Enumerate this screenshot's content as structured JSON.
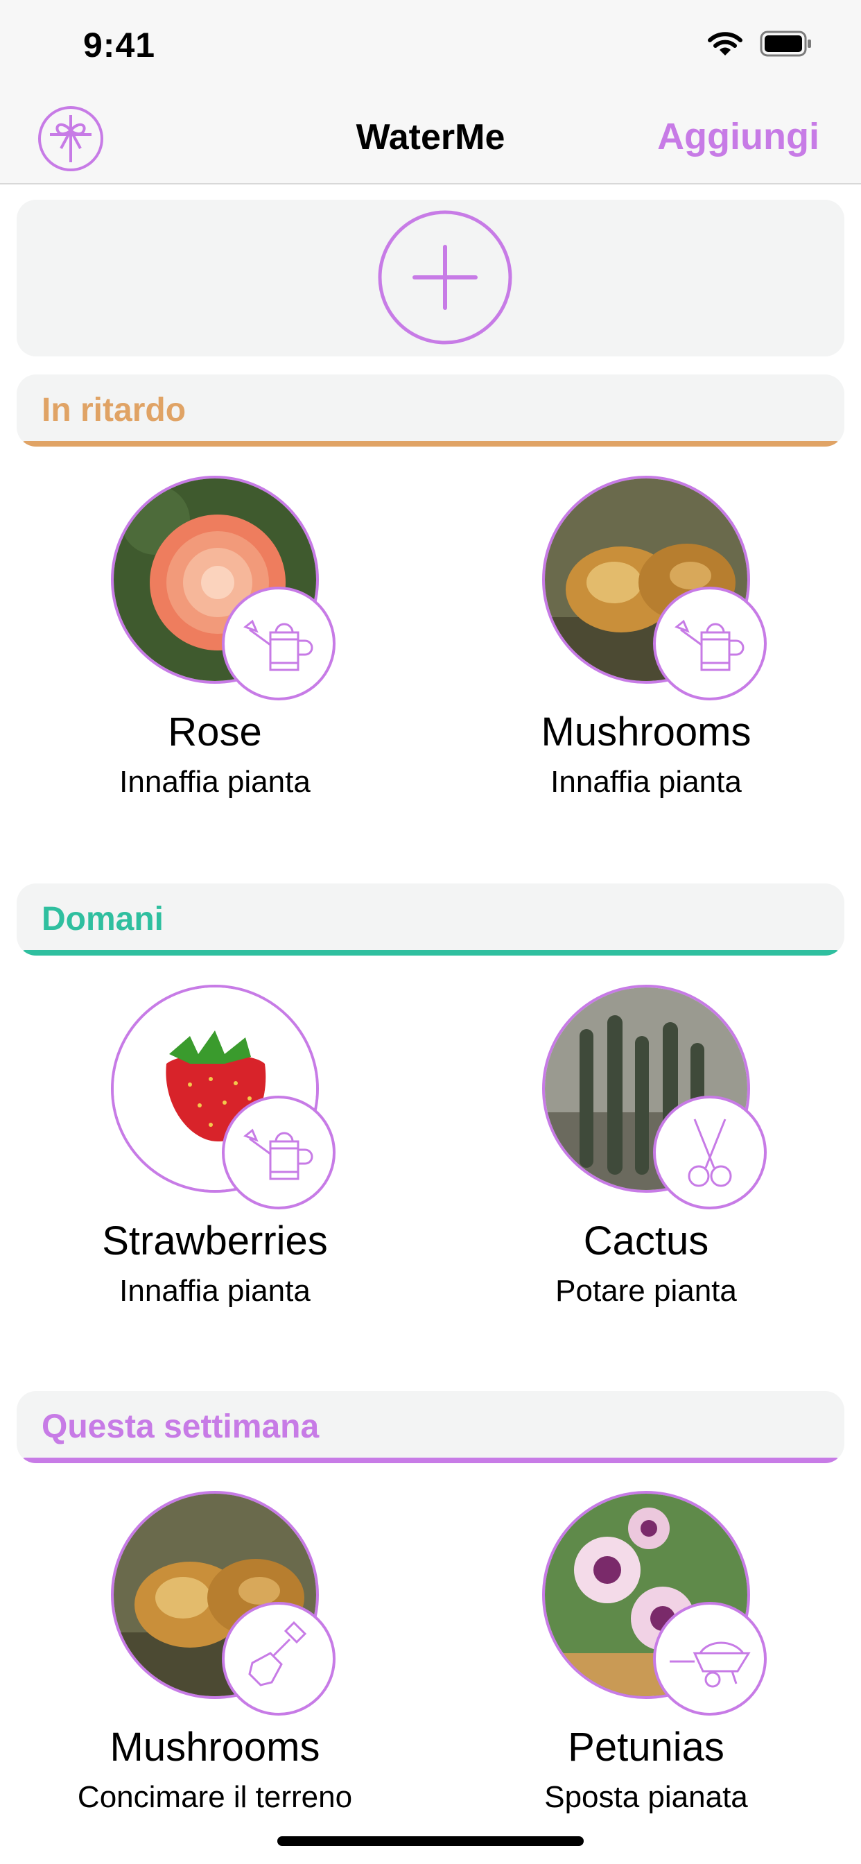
{
  "status": {
    "time": "9:41"
  },
  "nav": {
    "title": "WaterMe",
    "add_label": "Aggiungi"
  },
  "colors": {
    "accent": "#c77be6",
    "late": "#e0a365",
    "tomorrow": "#2fbf9f",
    "week": "#c77be6"
  },
  "sections": [
    {
      "title": "In ritardo",
      "color": "#e0a365",
      "items": [
        {
          "name": "Rose",
          "action": "Innaffia pianta",
          "icon": "watering-can-icon"
        },
        {
          "name": "Mushrooms",
          "action": "Innaffia pianta",
          "icon": "watering-can-icon"
        }
      ]
    },
    {
      "title": "Domani",
      "color": "#2fbf9f",
      "items": [
        {
          "name": "Strawberries",
          "action": "Innaffia pianta",
          "icon": "watering-can-icon"
        },
        {
          "name": "Cactus",
          "action": "Potare pianta",
          "icon": "scissors-icon"
        }
      ]
    },
    {
      "title": "Questa settimana",
      "color": "#c77be6",
      "items": [
        {
          "name": "Mushrooms",
          "action": "Concimare il terreno",
          "icon": "shovel-icon"
        },
        {
          "name": "Petunias",
          "action": "Sposta pianata",
          "icon": "wheelbarrow-icon"
        }
      ]
    }
  ]
}
